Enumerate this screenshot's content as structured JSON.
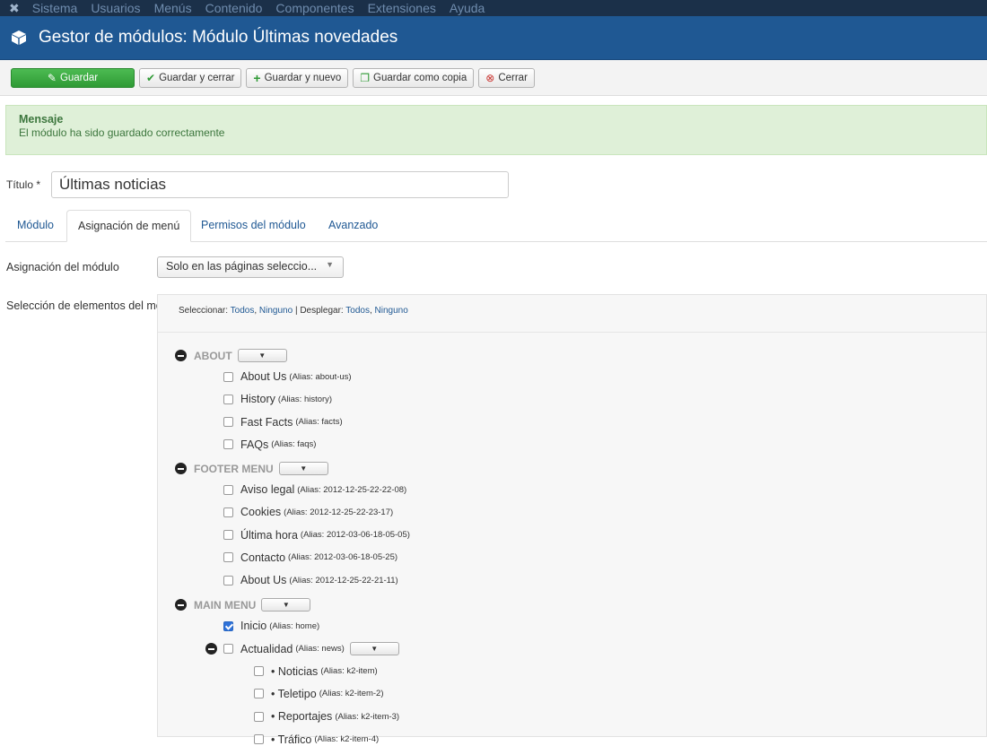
{
  "navbar": {
    "items": [
      "Sistema",
      "Usuarios",
      "Menús",
      "Contenido",
      "Componentes",
      "Extensiones",
      "Ayuda"
    ]
  },
  "header": {
    "title": "Gestor de módulos: Módulo Últimas novedades"
  },
  "toolbar": {
    "save": "Guardar",
    "save_close": "Guardar y cerrar",
    "save_new": "Guardar y nuevo",
    "save_copy": "Guardar como copia",
    "close": "Cerrar"
  },
  "alert": {
    "heading": "Mensaje",
    "body": "El módulo ha sido guardado correctamente"
  },
  "form": {
    "title_label": "Título *",
    "title_value": "Últimas noticias"
  },
  "tabs": [
    "Módulo",
    "Asignación de menú",
    "Permisos del módulo",
    "Avanzado"
  ],
  "assignment": {
    "label": "Asignación del módulo",
    "value": "Solo en las páginas seleccio..."
  },
  "selection": {
    "label": "Selección de elementos del menú:",
    "select_label": "Seleccionar:",
    "all": "Todos",
    "none": "Ninguno",
    "sep": "|",
    "expand_label": "Desplegar:",
    "all2": "Todos",
    "none2": "Ninguno"
  },
  "menus": [
    {
      "name": "ABOUT",
      "items": [
        {
          "label": "About Us",
          "alias": "(Alias: about-us)",
          "checked": false
        },
        {
          "label": "History",
          "alias": "(Alias: history)",
          "checked": false
        },
        {
          "label": "Fast Facts",
          "alias": "(Alias: facts)",
          "checked": false
        },
        {
          "label": "FAQs",
          "alias": "(Alias: faqs)",
          "checked": false
        }
      ]
    },
    {
      "name": "FOOTER MENU",
      "items": [
        {
          "label": "Aviso legal",
          "alias": "(Alias: 2012-12-25-22-22-08)",
          "checked": false
        },
        {
          "label": "Cookies",
          "alias": "(Alias: 2012-12-25-22-23-17)",
          "checked": false
        },
        {
          "label": "Última hora",
          "alias": "(Alias: 2012-03-06-18-05-05)",
          "checked": false
        },
        {
          "label": "Contacto",
          "alias": "(Alias: 2012-03-06-18-05-25)",
          "checked": false
        },
        {
          "label": "About Us",
          "alias": "(Alias: 2012-12-25-22-21-11)",
          "checked": false
        }
      ]
    },
    {
      "name": "MAIN MENU",
      "items": [
        {
          "label": "Inicio",
          "alias": "(Alias: home)",
          "checked": true
        },
        {
          "label": "Actualidad",
          "alias": "(Alias: news)",
          "checked": false
        },
        {
          "label": "• Noticias",
          "alias": "(Alias: k2-item)",
          "checked": false
        },
        {
          "label": "• Teletipo",
          "alias": "(Alias: k2-item-2)",
          "checked": false
        },
        {
          "label": "• Reportajes",
          "alias": "(Alias: k2-item-3)",
          "checked": false
        },
        {
          "label": "• Tráfico",
          "alias": "(Alias: k2-item-4)",
          "checked": false
        }
      ]
    }
  ]
}
